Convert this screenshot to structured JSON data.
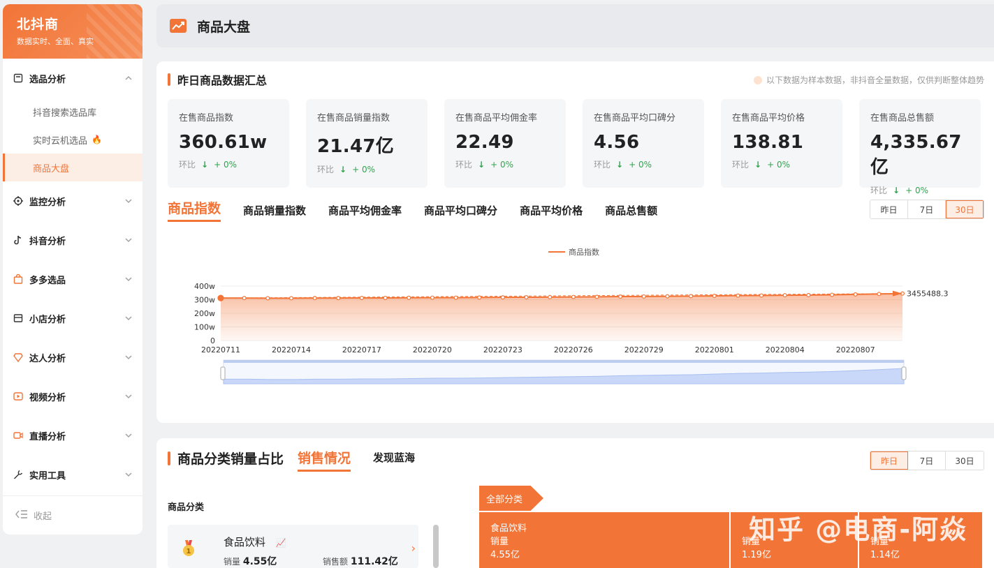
{
  "brand": {
    "name": "北抖商",
    "slogan": "数据实时、全面、真实"
  },
  "sidebar": {
    "groups": [
      {
        "label": "选品分析",
        "icon": "clipboard-icon",
        "expanded": true,
        "items": [
          {
            "label": "抖音搜索选品库"
          },
          {
            "label": "实时云机选品",
            "badge": "fire-icon"
          },
          {
            "label": "商品大盘",
            "active": true
          }
        ]
      },
      {
        "label": "监控分析",
        "icon": "crosshair-icon"
      },
      {
        "label": "抖音分析",
        "icon": "tiktok-icon"
      },
      {
        "label": "多多选品",
        "icon": "shopping-bag-icon"
      },
      {
        "label": "小店分析",
        "icon": "store-icon"
      },
      {
        "label": "达人分析",
        "icon": "diamond-icon"
      },
      {
        "label": "视频分析",
        "icon": "video-play-icon"
      },
      {
        "label": "直播分析",
        "icon": "live-camera-icon"
      },
      {
        "label": "实用工具",
        "icon": "wrench-icon"
      }
    ],
    "collapse_label": "收起"
  },
  "header": {
    "title": "商品大盘",
    "icon": "trend-chart-icon"
  },
  "summary": {
    "title": "昨日商品数据汇总",
    "notice": "以下数据为样本数据，非抖音全量数据，仅供判断整体趋势",
    "cards": [
      {
        "label": "在售商品指数",
        "value": "360.61w",
        "compare_label": "环比",
        "change": "+ 0%"
      },
      {
        "label": "在售商品销量指数",
        "value": "21.47亿",
        "compare_label": "环比",
        "change": "+ 0%"
      },
      {
        "label": "在售商品平均佣金率",
        "value": "22.49",
        "compare_label": "环比",
        "change": "+ 0%"
      },
      {
        "label": "在售商品平均口碑分",
        "value": "4.56",
        "compare_label": "环比",
        "change": "+ 0%"
      },
      {
        "label": "在售商品平均价格",
        "value": "138.81",
        "compare_label": "环比",
        "change": "+ 0%"
      },
      {
        "label": "在售商品总售额",
        "value": "4,335.67亿",
        "compare_label": "环比",
        "change": "+ 0%"
      }
    ]
  },
  "metric_tabs": [
    "商品指数",
    "商品销量指数",
    "商品平均佣金率",
    "商品平均口碑分",
    "商品平均价格",
    "商品总售额"
  ],
  "metric_tab_active": 0,
  "range1": {
    "options": [
      "昨日",
      "7日",
      "30日"
    ],
    "active": 2
  },
  "chart_data": {
    "type": "line",
    "legend": "商品指数",
    "y_ticks": [
      "400w",
      "300w",
      "200w",
      "100w",
      "0"
    ],
    "ylim": [
      0,
      4000000
    ],
    "x_tick_labels": [
      "20220711",
      "20220714",
      "20220717",
      "20220720",
      "20220723",
      "20220726",
      "20220729",
      "20220801",
      "20220804",
      "20220807"
    ],
    "x": [
      "20220711",
      "20220712",
      "20220713",
      "20220714",
      "20220715",
      "20220716",
      "20220717",
      "20220718",
      "20220719",
      "20220720",
      "20220721",
      "20220722",
      "20220723",
      "20220724",
      "20220725",
      "20220726",
      "20220727",
      "20220728",
      "20220729",
      "20220730",
      "20220731",
      "20220801",
      "20220802",
      "20220803",
      "20220804",
      "20220805",
      "20220806",
      "20220807",
      "20220808",
      "20220809"
    ],
    "series": [
      {
        "values": [
          3120000,
          3120000,
          3110000,
          3110000,
          3120000,
          3120000,
          3130000,
          3130000,
          3140000,
          3150000,
          3150000,
          3160000,
          3170000,
          3180000,
          3190000,
          3200000,
          3210000,
          3230000,
          3240000,
          3250000,
          3260000,
          3280000,
          3300000,
          3310000,
          3330000,
          3340000,
          3360000,
          3390000,
          3420000,
          3455488.3
        ]
      }
    ],
    "markline_label": "3455488.3",
    "color": "#f27437"
  },
  "category_section": {
    "title": "商品分类销量占比",
    "tabs": [
      "销售情况",
      "发现蓝海"
    ],
    "active_tab": 0,
    "range": {
      "options": [
        "昨日",
        "7日",
        "30日"
      ],
      "active": 0
    },
    "list_label": "商品分类",
    "top_item": {
      "name": "食品饮料",
      "sales_label": "销量",
      "sales": "4.55亿",
      "revenue_label": "销售额",
      "revenue": "111.42亿"
    },
    "crumb": "全部分类",
    "treemap": [
      {
        "name": "食品饮料",
        "metric": "销量",
        "value": "4.55亿"
      },
      {
        "name": "",
        "metric": "销量",
        "value": "1.19亿"
      },
      {
        "name": "",
        "metric": "销量",
        "value": "1.14亿"
      }
    ],
    "watermark": "知乎 @电商-阿焱"
  }
}
